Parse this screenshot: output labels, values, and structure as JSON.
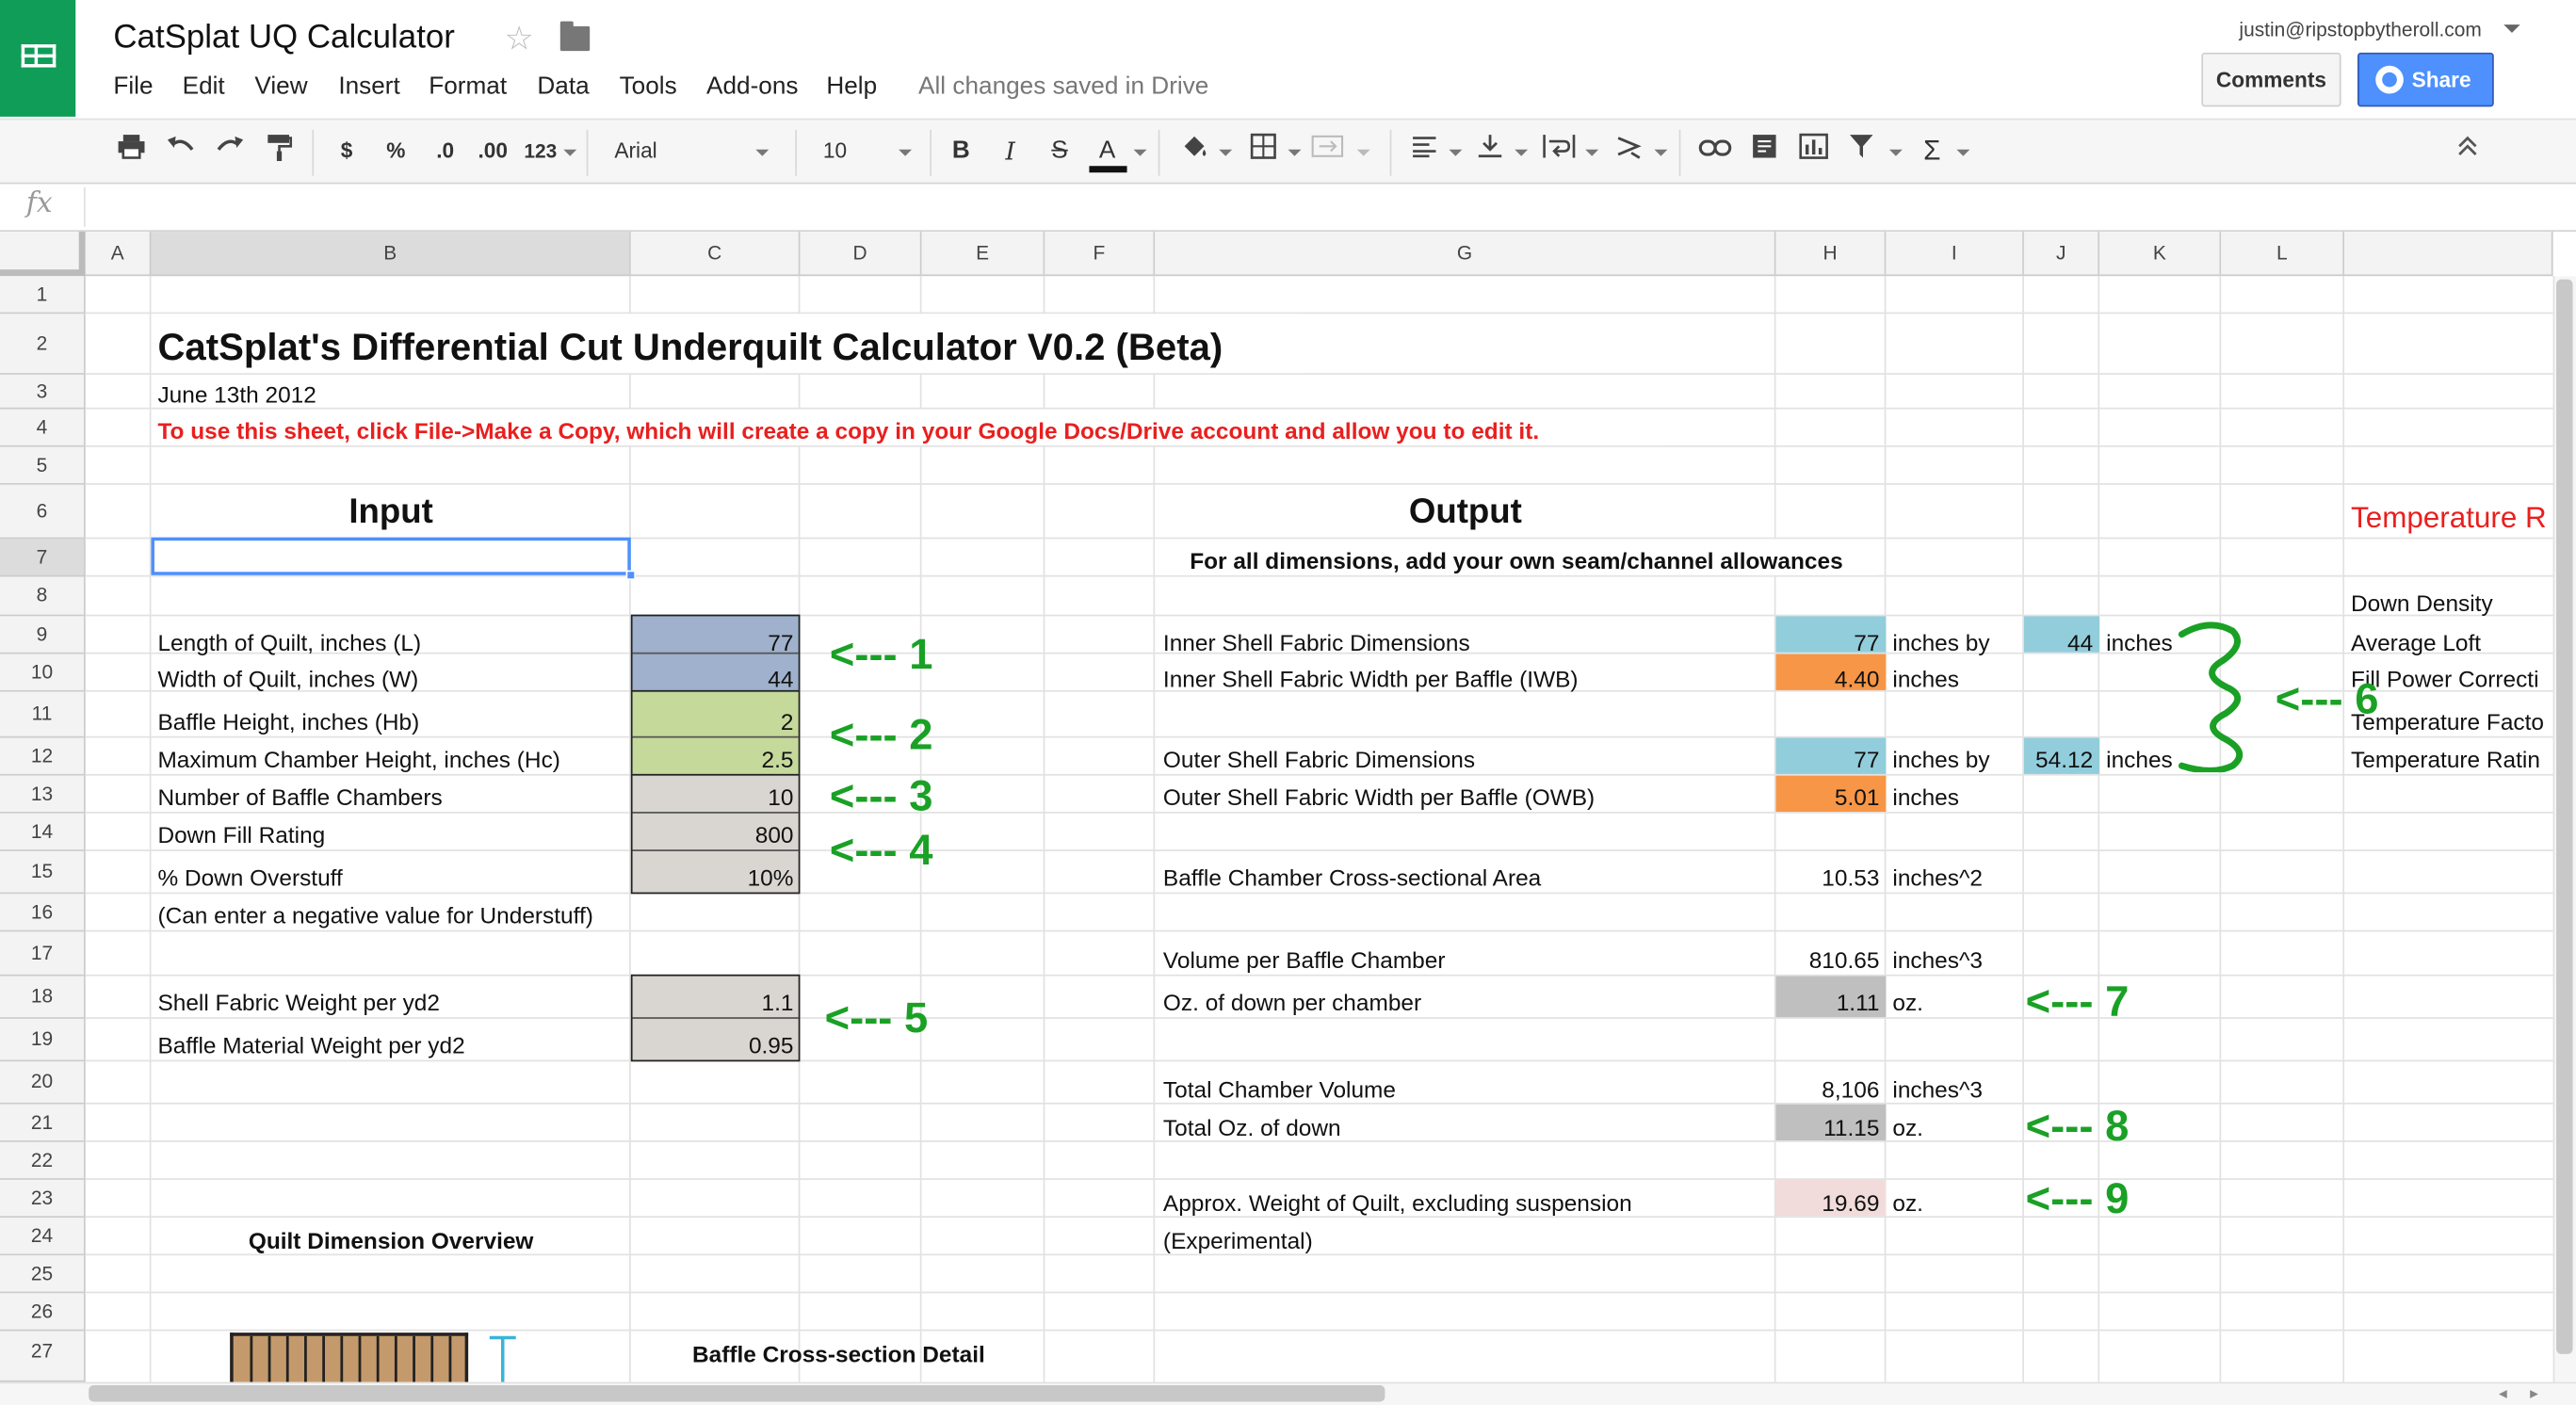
{
  "app": {
    "title": "CatSplat UQ Calculator",
    "icon": "sheets-logo-icon",
    "menus": [
      "File",
      "Edit",
      "View",
      "Insert",
      "Format",
      "Data",
      "Tools",
      "Add-ons",
      "Help"
    ],
    "save_status": "All changes saved in Drive",
    "user_email": "justin@ripstopbytheroll.com",
    "comments_label": "Comments",
    "share_label": "Share",
    "brand_color": "#0f9d58",
    "share_color": "#4d90fe"
  },
  "toolbar": {
    "currency": "$",
    "percent": "%",
    "dec_decrease": ".0",
    "dec_increase": ".00",
    "more_formats": "123",
    "font": "Arial",
    "font_size": "10",
    "bold": "B",
    "italic": "I",
    "strike": "S",
    "text_color": "A",
    "sum": "Σ",
    "icons": [
      "print-icon",
      "undo-icon",
      "redo-icon",
      "paint-format-icon",
      "fill-color-icon",
      "borders-icon",
      "merge-cells-icon",
      "align-left-icon",
      "valign-bottom-icon",
      "wrap-icon",
      "text-rotation-icon",
      "link-icon",
      "comment-icon",
      "chart-icon",
      "filter-icon",
      "functions-icon",
      "collapse-icon"
    ]
  },
  "formula_bar": {
    "label": "fx",
    "value": ""
  },
  "sheet": {
    "columns": [
      "A",
      "B",
      "C",
      "D",
      "E",
      "F",
      "G",
      "H",
      "I",
      "J",
      "K",
      "L"
    ],
    "selected_column": "B",
    "selected_row": "7",
    "selected_cell": "B7",
    "rows": [
      "1",
      "2",
      "3",
      "4",
      "5",
      "6",
      "7",
      "8",
      "9",
      "10",
      "11",
      "12",
      "13",
      "14",
      "15",
      "16",
      "17",
      "18",
      "19",
      "20",
      "21",
      "22",
      "23",
      "24",
      "25",
      "26",
      "27"
    ],
    "title": "CatSplat's Differential Cut Underquilt Calculator V0.2 (Beta)",
    "date": "June 13th 2012",
    "instruction": "To use this sheet, click File->Make a Copy, which will create a copy in your Google Docs/Drive account and allow you to edit it.",
    "input_heading": "Input",
    "output_heading": "Output",
    "output_note": "For all dimensions, add your own seam/channel allowances",
    "temperature_heading": "Temperature R",
    "inputs": [
      {
        "label": "Length of Quilt, inches (L)",
        "value": "77",
        "color": "#9fb1cc"
      },
      {
        "label": "Width of Quilt, inches (W)",
        "value": "44",
        "color": "#9fb1cc"
      },
      {
        "label": "Baffle Height, inches (Hb)",
        "value": "2",
        "color": "#c5d99b"
      },
      {
        "label": "Maximum Chamber Height, inches (Hc)",
        "value": "2.5",
        "color": "#c5d99b"
      },
      {
        "label": "Number of Baffle Chambers",
        "value": "10",
        "color": "#d9d6d1"
      },
      {
        "label": "Down Fill Rating",
        "value": "800",
        "color": "#d9d6d1"
      },
      {
        "label": "% Down Overstuff",
        "value": "10%",
        "color": "#d9d6d1"
      },
      {
        "label": "(Can enter a negative value for Understuff)",
        "value": ""
      },
      {
        "label": "Shell Fabric Weight per yd2",
        "value": "1.1",
        "color": "#d9d6d1"
      },
      {
        "label": "Baffle Material Weight per yd2",
        "value": "0.95",
        "color": "#d9d6d1"
      }
    ],
    "outputs": [
      {
        "label": "Inner Shell Fabric Dimensions",
        "value": "77",
        "unit": "inches by",
        "value2": "44",
        "unit2": "inches",
        "color": "#92cddc"
      },
      {
        "label": "Inner Shell Fabric Width per Baffle (IWB)",
        "value": "4.40",
        "unit": "inches",
        "color": "#f79646"
      },
      {
        "label": "Outer Shell Fabric Dimensions",
        "value": "77",
        "unit": "inches by",
        "value2": "54.12",
        "unit2": "inches",
        "color": "#92cddc"
      },
      {
        "label": "Outer Shell Fabric Width per Baffle (OWB)",
        "value": "5.01",
        "unit": "inches",
        "color": "#f79646"
      },
      {
        "label": "Baffle Chamber Cross-sectional Area",
        "value": "10.53",
        "unit": "inches^2"
      },
      {
        "label": "Volume per Baffle Chamber",
        "value": "810.65",
        "unit": "inches^3"
      },
      {
        "label": "Oz. of down per chamber",
        "value": "1.11",
        "unit": "oz.",
        "color": "#bfbfbf"
      },
      {
        "label": "Total Chamber Volume",
        "value": "8,106",
        "unit": "inches^3"
      },
      {
        "label": "Total Oz. of down",
        "value": "11.15",
        "unit": "oz.",
        "color": "#bfbfbf"
      },
      {
        "label": "Approx. Weight of Quilt, excluding suspension",
        "value": "19.69",
        "unit": "oz.",
        "color": "#f2dcdb"
      },
      {
        "label": "(Experimental)",
        "value": "",
        "unit": ""
      }
    ],
    "temperature_labels": [
      "Down Density",
      "Average Loft",
      "Fill Power Correcti",
      "Temperature Facto",
      "Temperature Ratin"
    ],
    "quilt_overview_label": "Quilt Dimension Overview",
    "baffle_detail_label": "Baffle Cross-section Detail"
  },
  "annotations": {
    "color": "#1aa125",
    "items": [
      "<--- 1",
      "<--- 2",
      "<--- 3",
      "<--- 4",
      "<--- 5",
      "<--- 6",
      "<--- 7",
      "<--- 8",
      "<--- 9"
    ]
  }
}
